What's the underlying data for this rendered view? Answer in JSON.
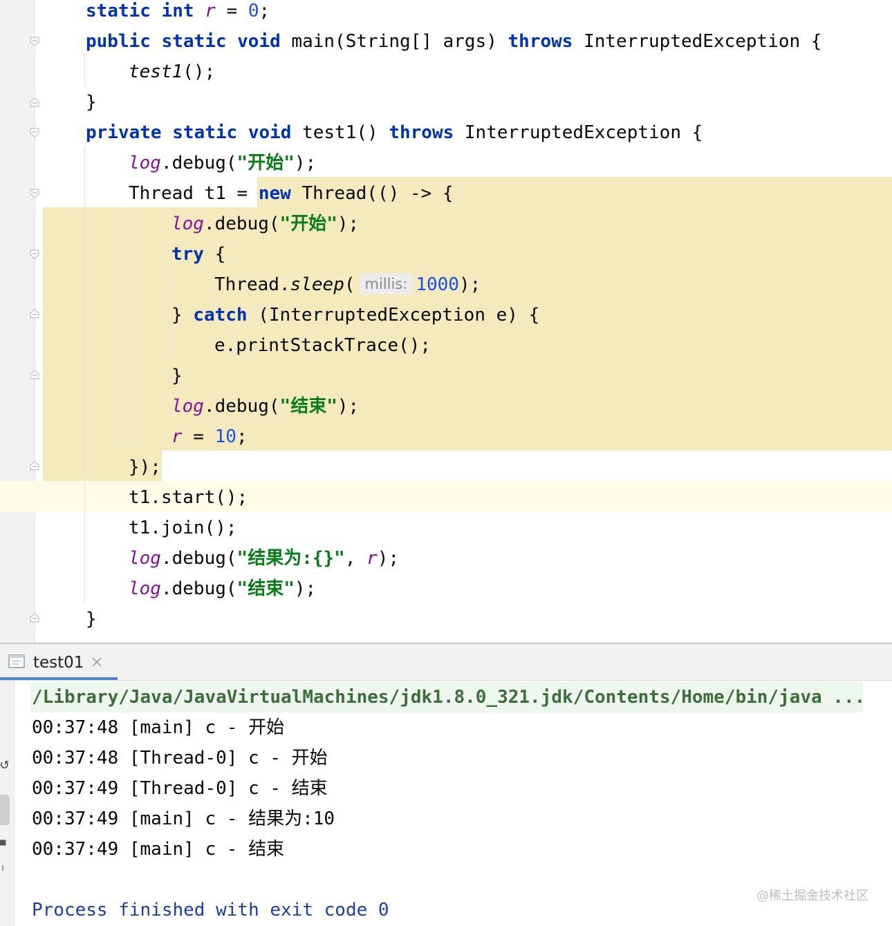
{
  "editor": {
    "lines": [
      {
        "indent": 1,
        "parts": [
          {
            "t": "static",
            "c": "kw"
          },
          {
            "t": " "
          },
          {
            "t": "int",
            "c": "kw"
          },
          {
            "t": " "
          },
          {
            "t": "r",
            "c": "fld"
          },
          {
            "t": " = "
          },
          {
            "t": "0",
            "c": "num"
          },
          {
            "t": ";"
          }
        ]
      },
      {
        "indent": 1,
        "parts": [
          {
            "t": "public",
            "c": "kw"
          },
          {
            "t": " "
          },
          {
            "t": "static",
            "c": "kw"
          },
          {
            "t": " "
          },
          {
            "t": "void",
            "c": "kw"
          },
          {
            "t": " main(String[] args) "
          },
          {
            "t": "throws",
            "c": "kw"
          },
          {
            "t": " InterruptedException {"
          }
        ]
      },
      {
        "indent": 2,
        "parts": [
          {
            "t": "test1",
            "c": "ital"
          },
          {
            "t": "();"
          }
        ]
      },
      {
        "indent": 1,
        "parts": [
          {
            "t": "}"
          }
        ]
      },
      {
        "indent": 1,
        "parts": [
          {
            "t": "private",
            "c": "kw"
          },
          {
            "t": " "
          },
          {
            "t": "static",
            "c": "kw"
          },
          {
            "t": " "
          },
          {
            "t": "void",
            "c": "kw"
          },
          {
            "t": " test1() "
          },
          {
            "t": "throws",
            "c": "kw"
          },
          {
            "t": " InterruptedException {"
          }
        ]
      },
      {
        "indent": 2,
        "parts": [
          {
            "t": "log",
            "c": "fld"
          },
          {
            "t": ".debug("
          },
          {
            "t": "\"开始\"",
            "c": "str"
          },
          {
            "t": ");"
          }
        ]
      },
      {
        "indent": 2,
        "parts": [
          {
            "t": "Thread t1 = "
          },
          {
            "t": "new",
            "c": "kw"
          },
          {
            "t": " Thread(() -> {"
          }
        ]
      },
      {
        "indent": 3,
        "parts": [
          {
            "t": "log",
            "c": "fld"
          },
          {
            "t": ".debug("
          },
          {
            "t": "\"开始\"",
            "c": "str"
          },
          {
            "t": ");"
          }
        ]
      },
      {
        "indent": 3,
        "parts": [
          {
            "t": "try",
            "c": "kw"
          },
          {
            "t": " {"
          }
        ]
      },
      {
        "indent": 4,
        "parts": [
          {
            "t": "Thread."
          },
          {
            "t": "sleep",
            "c": "ital"
          },
          {
            "t": "("
          },
          {
            "t": "millis:",
            "c": "hint"
          },
          {
            "t": "1000",
            "c": "num"
          },
          {
            "t": ");"
          }
        ]
      },
      {
        "indent": 3,
        "parts": [
          {
            "t": "} "
          },
          {
            "t": "catch",
            "c": "kw"
          },
          {
            "t": " (InterruptedException e) {"
          }
        ]
      },
      {
        "indent": 4,
        "parts": [
          {
            "t": "e.printStackTrace();"
          }
        ]
      },
      {
        "indent": 3,
        "parts": [
          {
            "t": "}"
          }
        ]
      },
      {
        "indent": 3,
        "parts": [
          {
            "t": "log",
            "c": "fld"
          },
          {
            "t": ".debug("
          },
          {
            "t": "\"结束\"",
            "c": "str"
          },
          {
            "t": ");"
          }
        ]
      },
      {
        "indent": 3,
        "parts": [
          {
            "t": "r",
            "c": "fld"
          },
          {
            "t": " = "
          },
          {
            "t": "10",
            "c": "num"
          },
          {
            "t": ";"
          }
        ]
      },
      {
        "indent": 2,
        "parts": [
          {
            "t": "});"
          }
        ]
      },
      {
        "indent": 2,
        "parts": [
          {
            "t": "t1.start();"
          }
        ]
      },
      {
        "indent": 2,
        "parts": [
          {
            "t": "t1.join();"
          }
        ]
      },
      {
        "indent": 2,
        "parts": [
          {
            "t": "log",
            "c": "fld"
          },
          {
            "t": ".debug("
          },
          {
            "t": "\"结果为:{}\"",
            "c": "str"
          },
          {
            "t": ", "
          },
          {
            "t": "r",
            "c": "fld"
          },
          {
            "t": ");"
          }
        ]
      },
      {
        "indent": 2,
        "parts": [
          {
            "t": "log",
            "c": "fld"
          },
          {
            "t": ".debug("
          },
          {
            "t": "\"结束\"",
            "c": "str"
          },
          {
            "t": ");"
          }
        ]
      },
      {
        "indent": 1,
        "parts": [
          {
            "t": "}"
          }
        ]
      }
    ],
    "colors": {
      "keyword": "#0033b3",
      "number": "#1750eb",
      "string": "#067d17",
      "field": "#871094",
      "highlight": "#f5eabe"
    }
  },
  "run_panel": {
    "tab_label": "test01",
    "tab_icon": "console-icon",
    "close_icon": "close-icon"
  },
  "console": {
    "command": "/Library/Java/JavaVirtualMachines/jdk1.8.0_321.jdk/Contents/Home/bin/java ...",
    "output": [
      "00:37:48 [main] c - 开始",
      "00:37:48 [Thread-0] c - 开始",
      "00:37:49 [Thread-0] c - 结束",
      "00:37:49 [main] c - 结果为:10",
      "00:37:49 [main] c - 结束"
    ],
    "exit_message": "Process finished with exit code 0"
  },
  "watermark": "@稀土掘金技术社区"
}
